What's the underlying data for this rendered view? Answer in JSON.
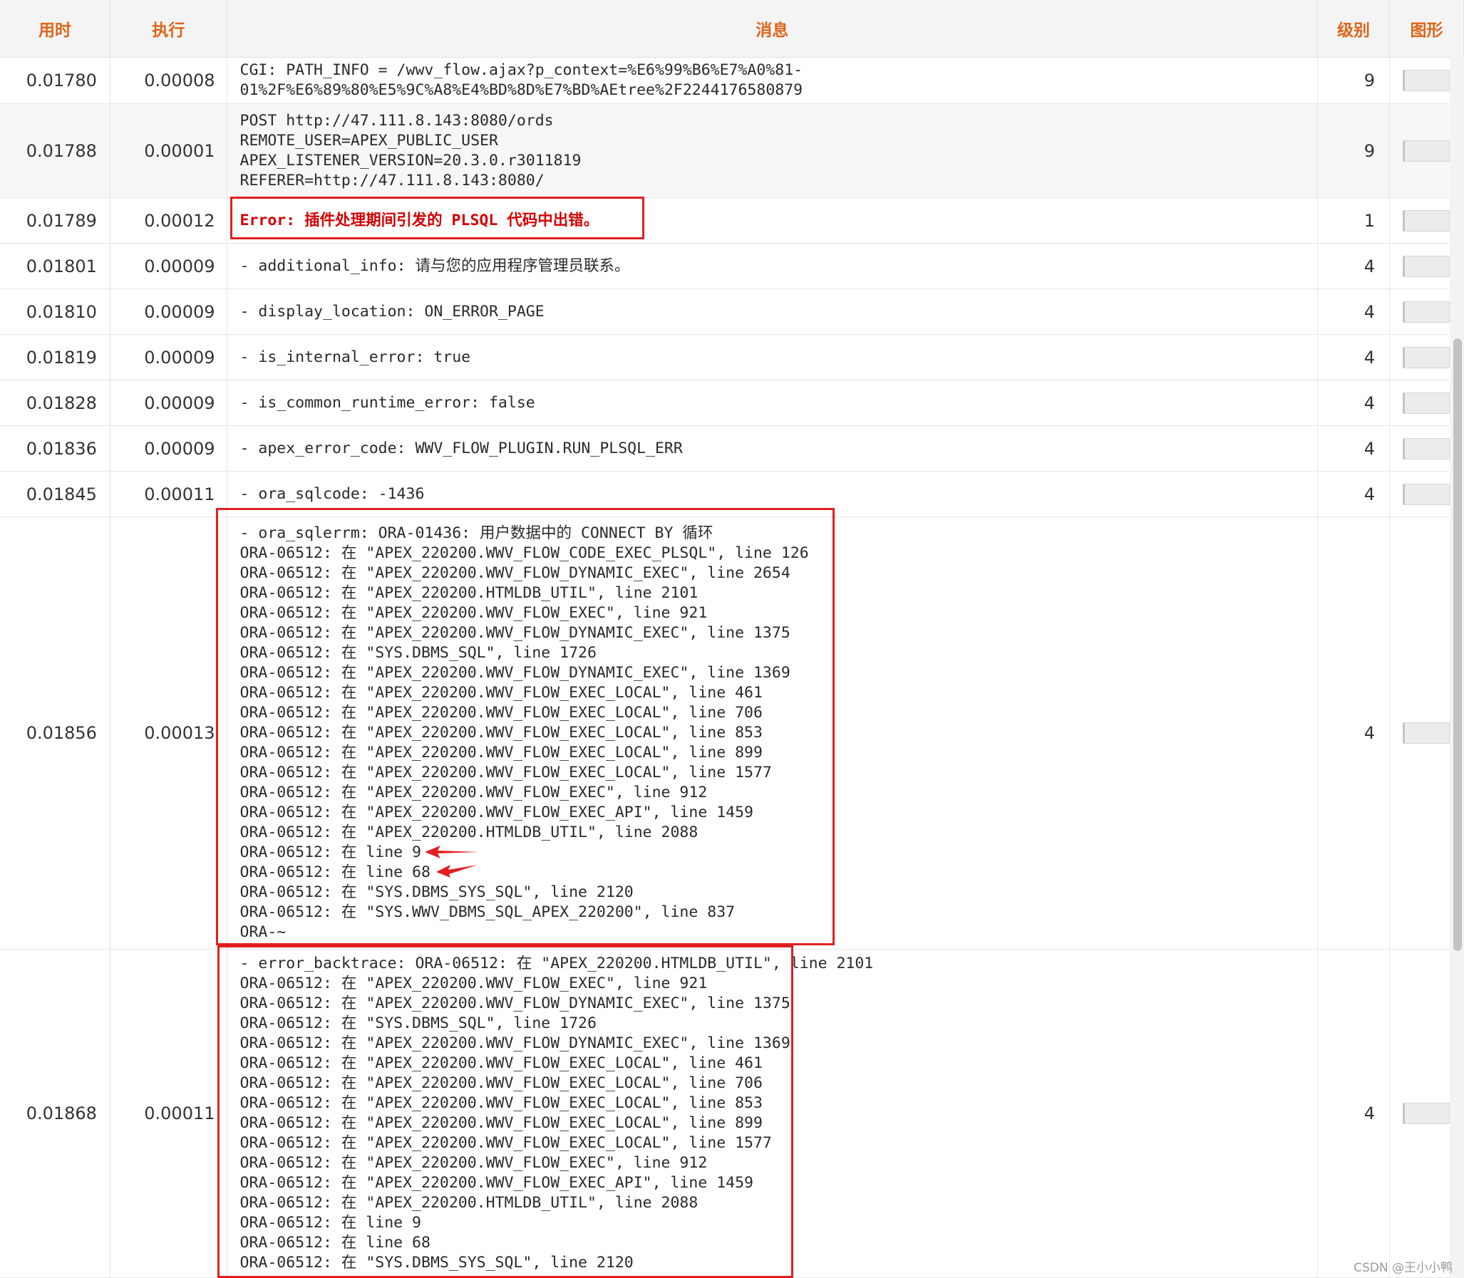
{
  "header": {
    "elapsed": "用时",
    "execution": "执行",
    "message": "消息",
    "level": "级别",
    "graph": "图形"
  },
  "rows": [
    {
      "elapsed": "0.01780",
      "execution": "0.00008",
      "level": "9",
      "message": "CGI: PATH_INFO = /wwv_flow.ajax?p_context=%E6%99%B6%E7%A0%81-\n01%2F%E6%89%80%E5%9C%A8%E4%BD%8D%E7%BD%AEtree%2F2244176580879"
    },
    {
      "elapsed": "0.01788",
      "execution": "0.00001",
      "level": "9",
      "message": "POST http://47.111.8.143:8080/ords\nREMOTE_USER=APEX_PUBLIC_USER\nAPEX_LISTENER_VERSION=20.3.0.r3011819\nREFERER=http://47.111.8.143:8080/"
    },
    {
      "elapsed": "0.01789",
      "execution": "0.00012",
      "level": "1",
      "message": "Error: 插件处理期间引发的 PLSQL 代码中出错。"
    },
    {
      "elapsed": "0.01801",
      "execution": "0.00009",
      "level": "4",
      "message": "- additional_info: 请与您的应用程序管理员联系。"
    },
    {
      "elapsed": "0.01810",
      "execution": "0.00009",
      "level": "4",
      "message": "- display_location: ON_ERROR_PAGE"
    },
    {
      "elapsed": "0.01819",
      "execution": "0.00009",
      "level": "4",
      "message": "- is_internal_error: true"
    },
    {
      "elapsed": "0.01828",
      "execution": "0.00009",
      "level": "4",
      "message": "- is_common_runtime_error: false"
    },
    {
      "elapsed": "0.01836",
      "execution": "0.00009",
      "level": "4",
      "message": "- apex_error_code: WWV_FLOW_PLUGIN.RUN_PLSQL_ERR"
    },
    {
      "elapsed": "0.01845",
      "execution": "0.00011",
      "level": "4",
      "message": "- ora_sqlcode: -1436"
    },
    {
      "elapsed": "0.01856",
      "execution": "0.00013",
      "level": "4",
      "message": "- ora_sqlerrm: ORA-01436: 用户数据中的 CONNECT BY 循环\nORA-06512: 在 \"APEX_220200.WWV_FLOW_CODE_EXEC_PLSQL\", line 126\nORA-06512: 在 \"APEX_220200.WWV_FLOW_DYNAMIC_EXEC\", line 2654\nORA-06512: 在 \"APEX_220200.HTMLDB_UTIL\", line 2101\nORA-06512: 在 \"APEX_220200.WWV_FLOW_EXEC\", line 921\nORA-06512: 在 \"APEX_220200.WWV_FLOW_DYNAMIC_EXEC\", line 1375\nORA-06512: 在 \"SYS.DBMS_SQL\", line 1726\nORA-06512: 在 \"APEX_220200.WWV_FLOW_DYNAMIC_EXEC\", line 1369\nORA-06512: 在 \"APEX_220200.WWV_FLOW_EXEC_LOCAL\", line 461\nORA-06512: 在 \"APEX_220200.WWV_FLOW_EXEC_LOCAL\", line 706\nORA-06512: 在 \"APEX_220200.WWV_FLOW_EXEC_LOCAL\", line 853\nORA-06512: 在 \"APEX_220200.WWV_FLOW_EXEC_LOCAL\", line 899\nORA-06512: 在 \"APEX_220200.WWV_FLOW_EXEC_LOCAL\", line 1577\nORA-06512: 在 \"APEX_220200.WWV_FLOW_EXEC\", line 912\nORA-06512: 在 \"APEX_220200.WWV_FLOW_EXEC_API\", line 1459\nORA-06512: 在 \"APEX_220200.HTMLDB_UTIL\", line 2088\nORA-06512: 在 line 9\nORA-06512: 在 line 68\nORA-06512: 在 \"SYS.DBMS_SYS_SQL\", line 2120\nORA-06512: 在 \"SYS.WWV_DBMS_SQL_APEX_220200\", line 837\nORA-~"
    },
    {
      "elapsed": "0.01868",
      "execution": "0.00011",
      "level": "4",
      "message": "- error_backtrace: ORA-06512: 在 \"APEX_220200.HTMLDB_UTIL\", line 2101\nORA-06512: 在 \"APEX_220200.WWV_FLOW_EXEC\", line 921\nORA-06512: 在 \"APEX_220200.WWV_FLOW_DYNAMIC_EXEC\", line 1375\nORA-06512: 在 \"SYS.DBMS_SQL\", line 1726\nORA-06512: 在 \"APEX_220200.WWV_FLOW_DYNAMIC_EXEC\", line 1369\nORA-06512: 在 \"APEX_220200.WWV_FLOW_EXEC_LOCAL\", line 461\nORA-06512: 在 \"APEX_220200.WWV_FLOW_EXEC_LOCAL\", line 706\nORA-06512: 在 \"APEX_220200.WWV_FLOW_EXEC_LOCAL\", line 853\nORA-06512: 在 \"APEX_220200.WWV_FLOW_EXEC_LOCAL\", line 899\nORA-06512: 在 \"APEX_220200.WWV_FLOW_EXEC_LOCAL\", line 1577\nORA-06512: 在 \"APEX_220200.WWV_FLOW_EXEC\", line 912\nORA-06512: 在 \"APEX_220200.WWV_FLOW_EXEC_API\", line 1459\nORA-06512: 在 \"APEX_220200.HTMLDB_UTIL\", line 2088\nORA-06512: 在 line 9\nORA-06512: 在 line 68\nORA-06512: 在 \"SYS.DBMS_SYS_SQL\", line 2120"
    }
  ],
  "watermark": "CSDN @王小小鸭",
  "colors": {
    "header_text": "#e0651a",
    "error_text": "#d40000",
    "highlight_box": "#e02020"
  }
}
